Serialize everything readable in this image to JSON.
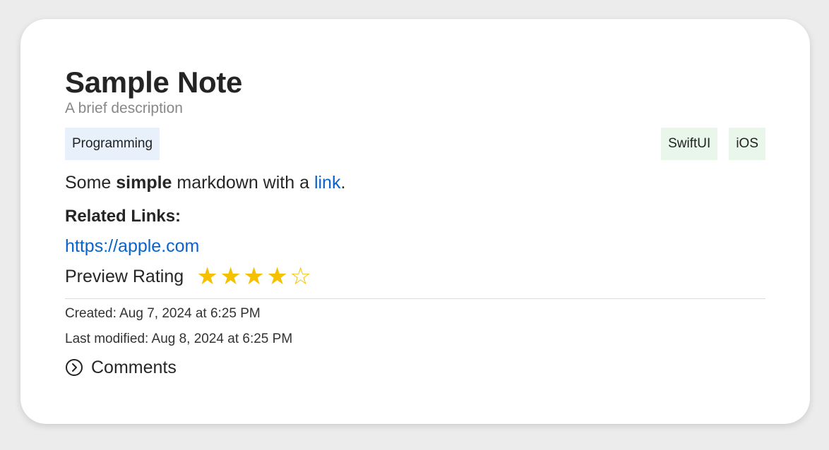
{
  "note": {
    "title": "Sample Note",
    "subtitle": "A brief description",
    "category_tag": "Programming",
    "tags": [
      "SwiftUI",
      "iOS"
    ],
    "body": {
      "prefix": "Some ",
      "bold": "simple",
      "middle": " markdown with a ",
      "link_text": "link",
      "suffix": "."
    },
    "related_heading": "Related Links:",
    "related_links": [
      "https://apple.com"
    ],
    "rating_label": "Preview Rating",
    "rating": 4,
    "rating_max": 5,
    "created": "Created: Aug 7, 2024 at 6:25 PM",
    "modified": "Last modified: Aug 8, 2024 at 6:25 PM",
    "comments_label": "Comments"
  },
  "colors": {
    "link": "#0a63cc",
    "star": "#f5c000",
    "category_tag_bg": "#e7f0fb",
    "tag_bg": "#e8f7ea"
  },
  "icons": {
    "star_filled": "star-filled-icon",
    "star_empty": "star-outline-icon",
    "comments": "chevron-right-circle-icon"
  }
}
